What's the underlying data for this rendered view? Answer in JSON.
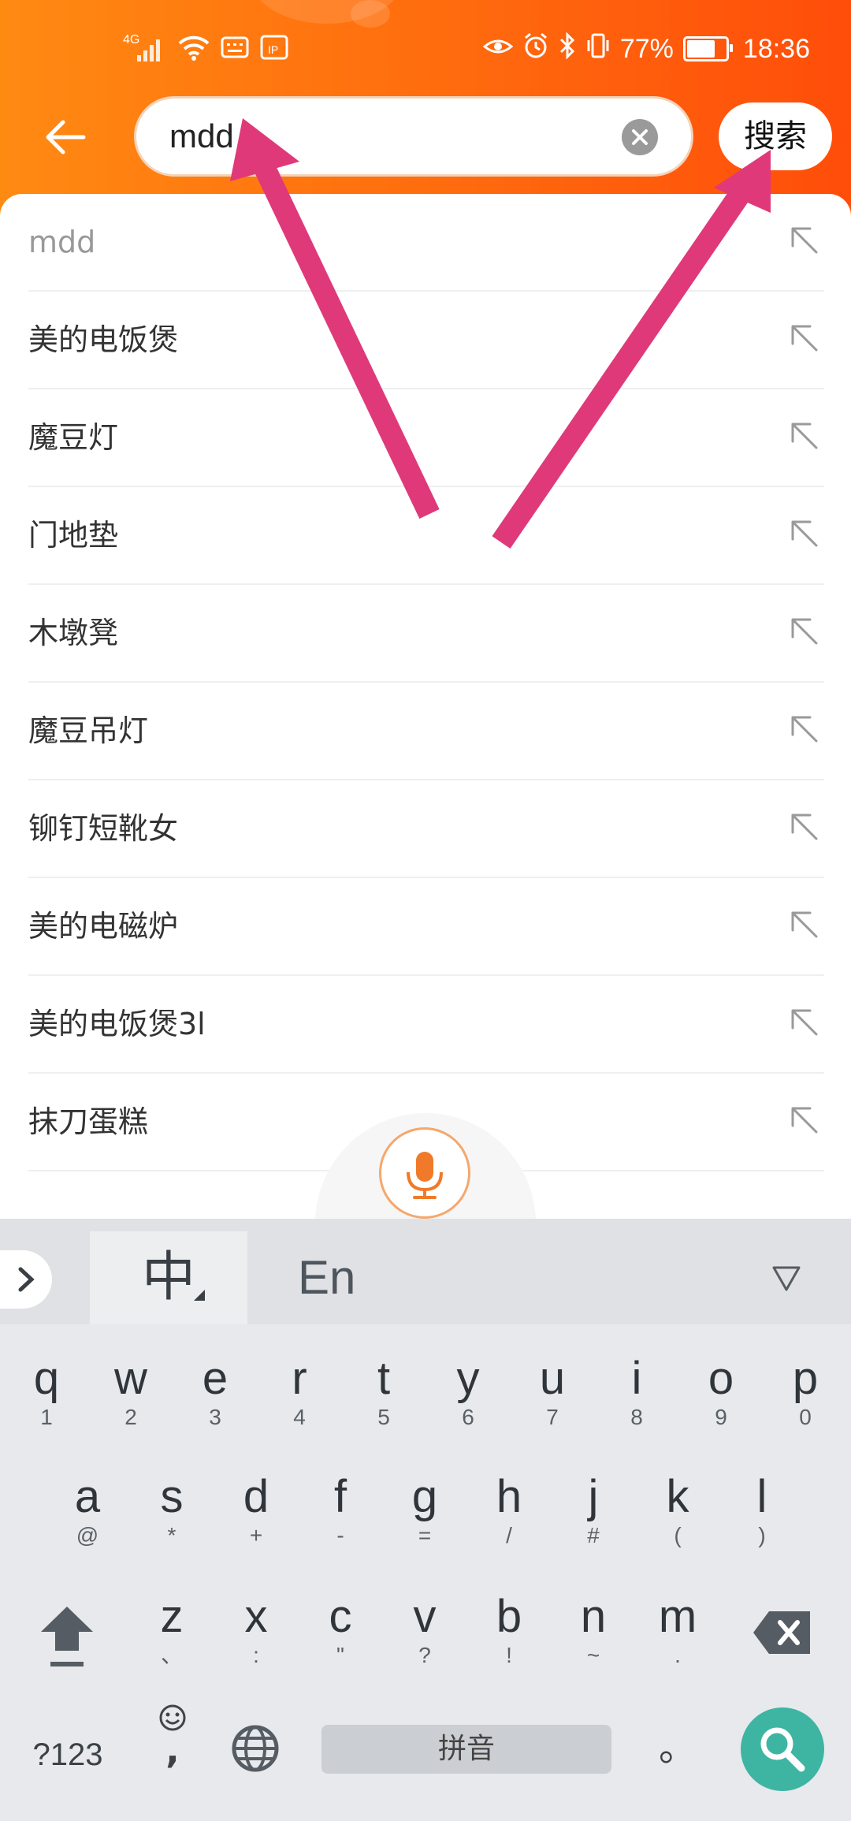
{
  "status_bar": {
    "network": "4G",
    "battery": "77%",
    "time": "18:36",
    "battery_level": 0.77
  },
  "search": {
    "query": "mdd",
    "button_label": "搜索"
  },
  "suggestions": [
    "mdd",
    "美的电饭煲",
    "魔豆灯",
    "门地垫",
    "木墩凳",
    "魔豆吊灯",
    "铆钉短靴女",
    "美的电磁炉",
    "美的电饭煲3l",
    "抹刀蛋糕"
  ],
  "keyboard": {
    "mode_zh": "中",
    "mode_en": "En",
    "row1": [
      {
        "k": "q",
        "s": "1"
      },
      {
        "k": "w",
        "s": "2"
      },
      {
        "k": "e",
        "s": "3"
      },
      {
        "k": "r",
        "s": "4"
      },
      {
        "k": "t",
        "s": "5"
      },
      {
        "k": "y",
        "s": "6"
      },
      {
        "k": "u",
        "s": "7"
      },
      {
        "k": "i",
        "s": "8"
      },
      {
        "k": "o",
        "s": "9"
      },
      {
        "k": "p",
        "s": "0"
      }
    ],
    "row2": [
      {
        "k": "a",
        "s": "@"
      },
      {
        "k": "s",
        "s": "*"
      },
      {
        "k": "d",
        "s": "+"
      },
      {
        "k": "f",
        "s": "-"
      },
      {
        "k": "g",
        "s": "="
      },
      {
        "k": "h",
        "s": "/"
      },
      {
        "k": "j",
        "s": "#"
      },
      {
        "k": "k",
        "s": "("
      },
      {
        "k": "l",
        "s": ")"
      }
    ],
    "row3": [
      {
        "k": "z",
        "s": "、"
      },
      {
        "k": "x",
        "s": ":"
      },
      {
        "k": "c",
        "s": "\""
      },
      {
        "k": "v",
        "s": "?"
      },
      {
        "k": "b",
        "s": "!"
      },
      {
        "k": "n",
        "s": "~"
      },
      {
        "k": "m",
        "s": "."
      }
    ],
    "numbers_label": "?123",
    "comma_label": ",",
    "space_label": "拼音",
    "period_label": "。"
  },
  "colors": {
    "header_start": "#ff8a12",
    "header_end": "#ff4d0a",
    "annotation_arrow": "#e0397a",
    "go_button": "#3db5a2",
    "mic_accent": "#f07a2a"
  }
}
